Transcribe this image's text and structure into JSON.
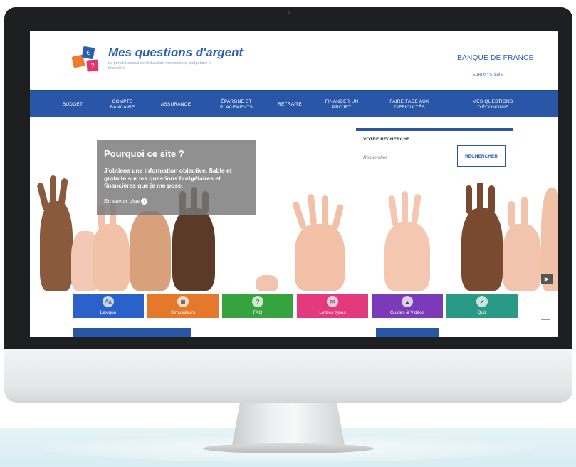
{
  "site": {
    "title": "Mes questions d'argent",
    "subtitle": "Le portail national de l'éducation économique, budgétaire et financière",
    "logo_cube_1": "€",
    "logo_cube_2": "?",
    "bank": "BANQUE DE FRANCE",
    "bank_sub": "EUROSYSTÈME"
  },
  "nav": {
    "items": [
      {
        "label": "BUDGET"
      },
      {
        "label": "COMPTE BANCAIRE"
      },
      {
        "label": "ASSURANCE"
      },
      {
        "label": "ÉPARGNE ET PLACEMENTS"
      },
      {
        "label": "RETRAITE"
      },
      {
        "label": "FINANCER UN PROJET"
      },
      {
        "label": "FAIRE FACE AUX DIFFICULTÉS"
      },
      {
        "label": "MES QUESTIONS D'ÉCONOMIE"
      }
    ]
  },
  "hero": {
    "title": "Pourquoi ce site ?",
    "text": "J'obtiens une information objective, fiable et gratuite sur les questions budgétaires et financières que je me pose.",
    "link": "En savoir plus",
    "link_icon": "›",
    "next_icon": "▶"
  },
  "search": {
    "label": "VOTRE RECHERCHE",
    "placeholder": "Rechercher",
    "button": "RECHERCHER"
  },
  "tiles": [
    {
      "label": "Lexique",
      "icon": "Aa",
      "color": "#2a62c9"
    },
    {
      "label": "Simulateurs",
      "icon": "▦",
      "color": "#e6782b"
    },
    {
      "label": "FAQ",
      "icon": "?",
      "color": "#36a33f"
    },
    {
      "label": "Lettres types",
      "icon": "✉",
      "color": "#e23a7c"
    },
    {
      "label": "Guides & Vidéos",
      "icon": "▲",
      "color": "#7b3ab8"
    },
    {
      "label": "Quiz",
      "icon": "✔",
      "color": "#2a9a86"
    }
  ],
  "colors": {
    "nav_blue": "#2a56a8",
    "brand_blue": "#2a5fb0",
    "overlay_gray": "#787878"
  }
}
